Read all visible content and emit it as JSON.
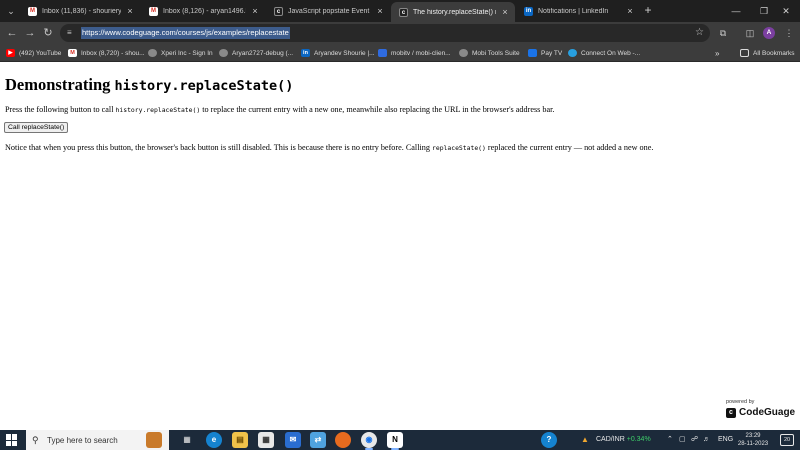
{
  "browser": {
    "tabs": [
      {
        "title": "Inbox (11,836) - shourieryandev",
        "favicon": "gmail-icon",
        "active": false
      },
      {
        "title": "Inbox (8,126) - aryan1496.be20",
        "favicon": "gmail-icon",
        "active": false
      },
      {
        "title": "JavaScript popstate Event - The",
        "favicon": "codeguage-icon",
        "active": false
      },
      {
        "title": "The history.replaceState() meth",
        "favicon": "codeguage-icon",
        "active": true
      },
      {
        "title": "Notifications | LinkedIn",
        "favicon": "linkedin-icon",
        "active": false
      }
    ],
    "address": {
      "url": "https://www.codeguage.com/courses/js/examples/replacestate"
    },
    "profile_initial": "A",
    "bookmarks": [
      {
        "label": "(492) YouTube",
        "icon": "youtube-icon"
      },
      {
        "label": "Inbox (8,720) - shou...",
        "icon": "gmail-icon"
      },
      {
        "label": "Xperi Inc - Sign In",
        "icon": "globe-icon"
      },
      {
        "label": "Aryan2727-debug (...",
        "icon": "globe-icon"
      },
      {
        "label": "Aryandev Shourie |...",
        "icon": "linkedin-icon"
      },
      {
        "label": "mobitv / mobi-clien...",
        "icon": "bitbucket-icon"
      },
      {
        "label": "Mobi Tools Suite",
        "icon": "globe-icon"
      },
      {
        "label": "Pay TV",
        "icon": "paytv-icon"
      },
      {
        "label": "Connect On Web -...",
        "icon": "connect-icon"
      }
    ],
    "all_bookmarks_label": "All Bookmarks"
  },
  "page": {
    "heading_text": "Demonstrating ",
    "heading_code": "history.replaceState()",
    "p1_before": "Press the following button to call ",
    "p1_code": "history.replaceState()",
    "p1_after": " to replace the current entry with a new one, meanwhile also replacing the URL in the browser's address bar.",
    "button_label": "Call replaceState()",
    "p2_before": "Notice that when you press this button, the browser's back button is still disabled. This is because there is no entry before. Calling ",
    "p2_code": "replaceState()",
    "p2_after": " replaced the current entry — not added a new one.",
    "powered_by": "powered by",
    "brand": "CodeGuage"
  },
  "taskbar": {
    "search_placeholder": "Type here to search",
    "ticker_label": "CAD/INR",
    "ticker_change": "+0.34%",
    "lang": "ENG",
    "time": "23:29",
    "date": "28-11-2023",
    "notification_count": "20"
  },
  "colors": {
    "tabstrip_bg": "#1f1f1f",
    "toolbar_bg": "#3c3c3c",
    "url_selection": "#3d5c8c",
    "taskbar_bg": "#1c2a3a",
    "ticker_up": "#3ecf6a"
  }
}
